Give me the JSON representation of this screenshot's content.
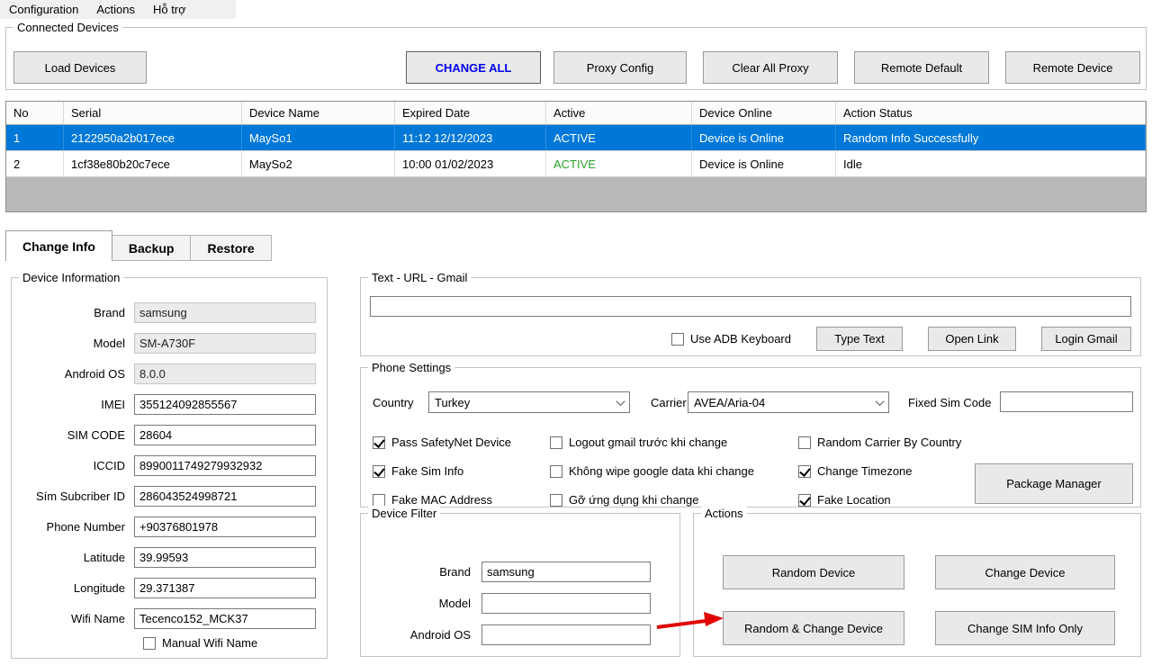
{
  "menu": {
    "items": [
      {
        "label": "Configuration"
      },
      {
        "label": "Actions"
      },
      {
        "label": "Hỗ trợ"
      }
    ]
  },
  "connected_devices": {
    "legend": "Connected Devices",
    "buttons": {
      "load_devices": "Load Devices",
      "change_all": "CHANGE ALL",
      "proxy_config": "Proxy Config",
      "clear_all_proxy": "Clear All Proxy",
      "remote_default": "Remote Default",
      "remote_device": "Remote Device"
    }
  },
  "device_table": {
    "columns": [
      "No",
      "Serial",
      "Device Name",
      "Expired Date",
      "Active",
      "Device Online",
      "Action Status"
    ],
    "rows": [
      {
        "no": "1",
        "serial": "2122950a2b017ece",
        "device_name": "MaySo1",
        "expired_date": "11:12 12/12/2023",
        "active": "ACTIVE",
        "device_online": "Device is Online",
        "action_status": "Random Info Successfully",
        "selected": true
      },
      {
        "no": "2",
        "serial": "1cf38e80b20c7ece",
        "device_name": "MaySo2",
        "expired_date": "10:00 01/02/2023",
        "active": "ACTIVE",
        "device_online": "Device is Online",
        "action_status": "Idle",
        "selected": false
      }
    ]
  },
  "tabs": [
    {
      "label": "Change Info",
      "active": true
    },
    {
      "label": "Backup",
      "active": false
    },
    {
      "label": "Restore",
      "active": false
    }
  ],
  "device_information": {
    "legend": "Device Information",
    "fields": [
      {
        "label": "Brand",
        "value": "samsung",
        "readonly": true
      },
      {
        "label": "Model",
        "value": "SM-A730F",
        "readonly": true
      },
      {
        "label": "Android OS",
        "value": "8.0.0",
        "readonly": true
      },
      {
        "label": "IMEI",
        "value": "355124092855567",
        "readonly": false
      },
      {
        "label": "SIM CODE",
        "value": "28604",
        "readonly": false
      },
      {
        "label": "ICCID",
        "value": "8990011749279932932",
        "readonly": false
      },
      {
        "label": "Sím Subcriber ID",
        "value": "286043524998721",
        "readonly": false
      },
      {
        "label": "Phone Number",
        "value": "+90376801978",
        "readonly": false
      },
      {
        "label": "Latitude",
        "value": "39.99593",
        "readonly": false
      },
      {
        "label": "Longitude",
        "value": "29.371387",
        "readonly": false
      },
      {
        "label": "Wifi Name",
        "value": "Tecenco152_MCK37",
        "readonly": false
      }
    ],
    "manual_wifi_checkbox": {
      "label": "Manual Wifi Name",
      "checked": false
    }
  },
  "text_url_gmail": {
    "legend": "Text - URL - Gmail",
    "input_value": "",
    "use_adb_keyboard": {
      "label": "Use ADB Keyboard",
      "checked": false
    },
    "buttons": {
      "type_text": "Type Text",
      "open_link": "Open Link",
      "login_gmail": "Login Gmail"
    }
  },
  "phone_settings": {
    "legend": "Phone Settings",
    "country": {
      "label": "Country",
      "value": "Turkey"
    },
    "carrier": {
      "label": "Carrier",
      "value": "AVEA/Aria-04"
    },
    "fixed_sim_code": {
      "label": "Fixed Sim Code",
      "value": ""
    },
    "checkboxes": [
      {
        "label": "Pass SafetyNet Device",
        "checked": true
      },
      {
        "label": "Logout gmail trước khi change",
        "checked": false
      },
      {
        "label": "Random Carrier By Country",
        "checked": false
      },
      {
        "label": "Fake Sim Info",
        "checked": true
      },
      {
        "label": "Không wipe google data khi change",
        "checked": false
      },
      {
        "label": "Change Timezone",
        "checked": true
      },
      {
        "label": "Fake MAC Address",
        "checked": false
      },
      {
        "label": "Gỡ ứng dụng khi change",
        "checked": false
      },
      {
        "label": "Fake Location",
        "checked": true
      }
    ],
    "package_manager_button": "Package Manager"
  },
  "device_filter": {
    "legend": "Device Filter",
    "fields": [
      {
        "label": "Brand",
        "value": "samsung"
      },
      {
        "label": "Model",
        "value": ""
      },
      {
        "label": "Android OS",
        "value": ""
      }
    ]
  },
  "actions_group": {
    "legend": "Actions",
    "buttons": {
      "random_device": "Random Device",
      "change_device": "Change Device",
      "random_change_device": "Random & Change Device",
      "change_sim_info_only": "Change SIM Info Only"
    }
  },
  "colors": {
    "selected_row_bg": "#0078d7",
    "active_status_green": "#28a228",
    "change_all_text_blue": "#0000ee",
    "annotation_arrow_red": "#e00000"
  }
}
